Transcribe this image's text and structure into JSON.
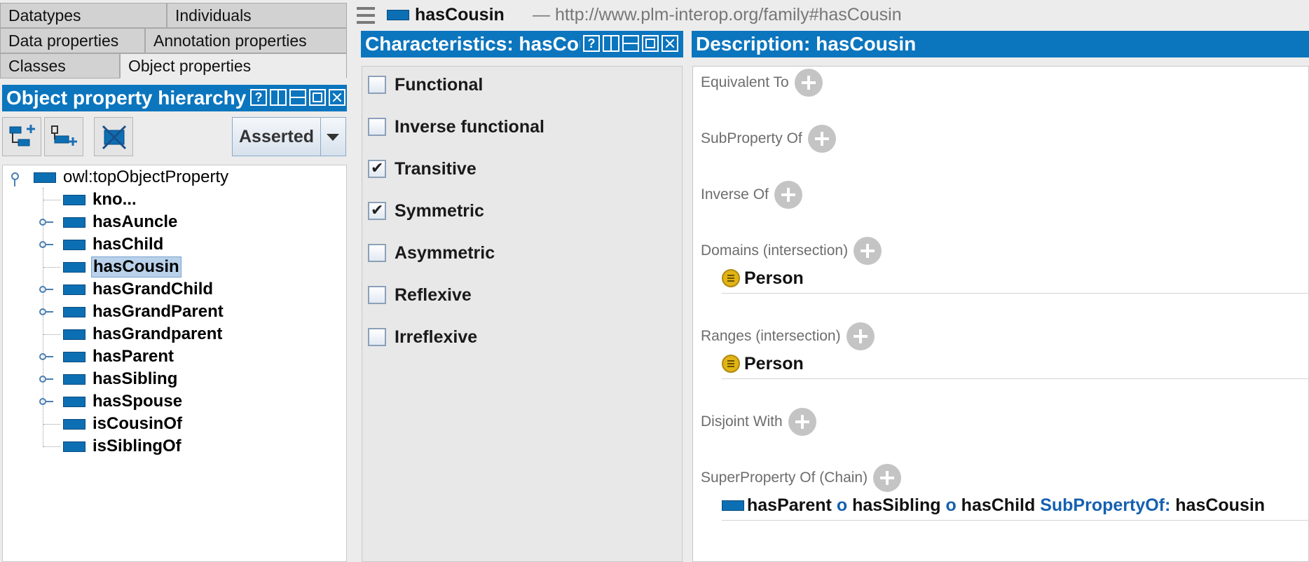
{
  "left_tabs": {
    "row1": [
      "Datatypes",
      "Individuals"
    ],
    "row2": [
      "Data properties",
      "Annotation properties"
    ],
    "row3": [
      "Classes",
      "Object properties"
    ],
    "selected": "Object properties"
  },
  "hierarchy_panel": {
    "title": "Object property hierarchy",
    "mode_dropdown": "Asserted",
    "root": "owl:topObjectProperty",
    "nodes": [
      {
        "label": "kno...",
        "has_children": false
      },
      {
        "label": "hasAuncle",
        "has_children": true
      },
      {
        "label": "hasChild",
        "has_children": true
      },
      {
        "label": "hasCousin",
        "has_children": false,
        "selected": true
      },
      {
        "label": "hasGrandChild",
        "has_children": true
      },
      {
        "label": "hasGrandParent",
        "has_children": true
      },
      {
        "label": "hasGrandparent",
        "has_children": false
      },
      {
        "label": "hasParent",
        "has_children": true
      },
      {
        "label": "hasSibling",
        "has_children": true
      },
      {
        "label": "hasSpouse",
        "has_children": true
      },
      {
        "label": "isCousinOf",
        "has_children": false
      },
      {
        "label": "isSiblingOf",
        "has_children": false
      }
    ]
  },
  "header": {
    "entity_name": "hasCousin",
    "entity_uri": "— http://www.plm-interop.org/family#hasCousin"
  },
  "characteristics": {
    "title": "Characteristics: hasCousin",
    "items": [
      {
        "label": "Functional",
        "checked": false
      },
      {
        "label": "Inverse functional",
        "checked": false
      },
      {
        "label": "Transitive",
        "checked": true
      },
      {
        "label": "Symmetric",
        "checked": true
      },
      {
        "label": "Asymmetric",
        "checked": false
      },
      {
        "label": "Reflexive",
        "checked": false
      },
      {
        "label": "Irreflexive",
        "checked": false
      }
    ]
  },
  "description": {
    "title": "Description: hasCousin",
    "sections": {
      "equivalent_to": "Equivalent To",
      "subproperty_of": "SubProperty Of",
      "inverse_of": "Inverse Of",
      "domains": "Domains (intersection)",
      "ranges": "Ranges (intersection)",
      "disjoint_with": "Disjoint With",
      "superproperty_chain": "SuperProperty Of (Chain)"
    },
    "domain_value": "Person",
    "range_value": "Person",
    "chain": {
      "p1": "hasParent",
      "op1": "o",
      "p2": "hasSibling",
      "op2": "o",
      "p3": "hasChild",
      "kw": "SubPropertyOf:",
      "target": "hasCousin"
    }
  },
  "colors": {
    "header_blue": "#0b75be",
    "property_icon": "#0d6fb3",
    "class_icon": "#e1b315",
    "keyword_blue": "#1560b0"
  }
}
